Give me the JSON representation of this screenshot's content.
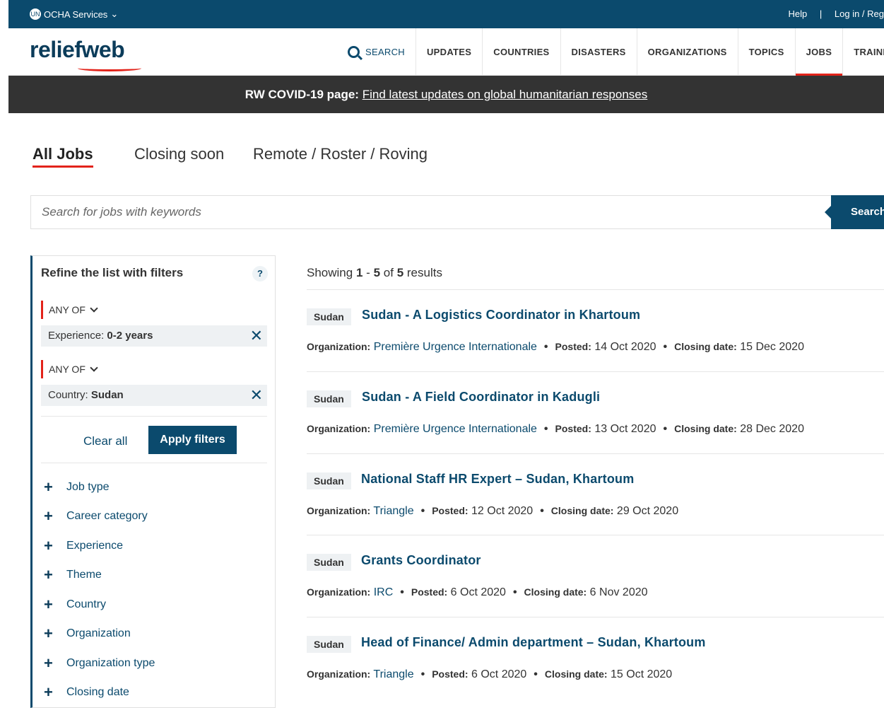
{
  "topbar": {
    "ocha_label": "OCHA Services",
    "help": "Help",
    "separator": "|",
    "login": "Log in / Reg"
  },
  "header": {
    "logo": "reliefweb",
    "nav": [
      "SEARCH",
      "UPDATES",
      "COUNTRIES",
      "DISASTERS",
      "ORGANIZATIONS",
      "TOPICS",
      "JOBS",
      "TRAINI"
    ]
  },
  "banner": {
    "prefix": "RW COVID-19 page:",
    "link": "Find latest updates on global humanitarian responses"
  },
  "tabs": [
    "All Jobs",
    "Closing soon",
    "Remote / Roster / Roving"
  ],
  "search": {
    "placeholder": "Search for jobs with keywords",
    "button": "Search"
  },
  "sidebar": {
    "title": "Refine the list with filters",
    "help": "?",
    "operator": "ANY OF",
    "filters": [
      {
        "label": "Experience:",
        "value": "0-2 years"
      },
      {
        "label": "Country:",
        "value": "Sudan"
      }
    ],
    "clear_all": "Clear all",
    "apply": "Apply filters",
    "facets": [
      "Job type",
      "Career category",
      "Experience",
      "Theme",
      "Country",
      "Organization",
      "Organization type",
      "Closing date"
    ]
  },
  "results": {
    "showing_prefix": "Showing",
    "from": "1",
    "dash": "-",
    "to": "5",
    "of": "of",
    "total": "5",
    "suffix": "results",
    "labels": {
      "org": "Organization:",
      "posted": "Posted:",
      "closing": "Closing date:"
    },
    "items": [
      {
        "country": "Sudan",
        "title": "Sudan - A Logistics Coordinator in Khartoum",
        "org": "Première Urgence Internationale",
        "posted": "14 Oct 2020",
        "closing": "15 Dec 2020"
      },
      {
        "country": "Sudan",
        "title": "Sudan - A Field Coordinator in Kadugli",
        "org": "Première Urgence Internationale",
        "posted": "13 Oct 2020",
        "closing": "28 Dec 2020"
      },
      {
        "country": "Sudan",
        "title": "National Staff HR Expert – Sudan, Khartoum",
        "org": "Triangle",
        "posted": "12 Oct 2020",
        "closing": "29 Oct 2020"
      },
      {
        "country": "Sudan",
        "title": "Grants Coordinator",
        "org": "IRC",
        "posted": "6 Oct 2020",
        "closing": "6 Nov 2020"
      },
      {
        "country": "Sudan",
        "title": "Head of Finance/ Admin department – Sudan, Khartoum",
        "org": "Triangle",
        "posted": "6 Oct 2020",
        "closing": "15 Oct 2020"
      }
    ]
  },
  "colors": {
    "primary": "#0b4a6d",
    "accent": "#e2231a",
    "banner": "#333333"
  }
}
